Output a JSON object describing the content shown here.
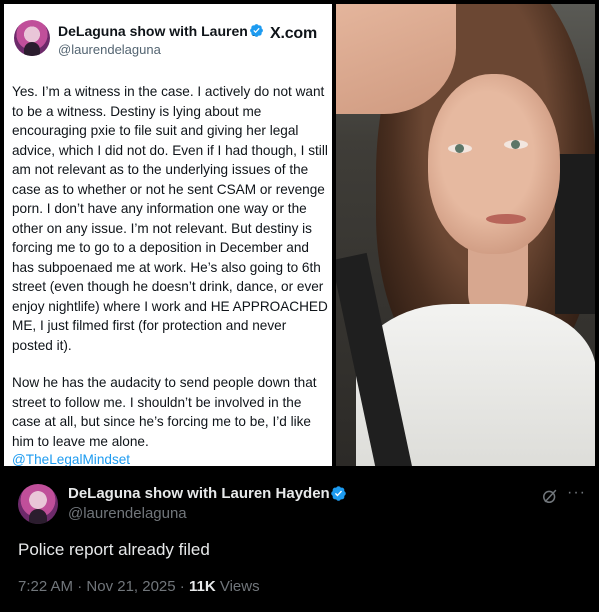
{
  "card": {
    "display_name": "DeLaguna show with Lauren H...",
    "handle": "@laurendelaguna",
    "brand": "X.com",
    "paragraph_1": "Yes. I’m a witness in the case. I actively do not want to be a witness. Destiny is lying about me encouraging pxie to file suit and giving her legal advice, which I did not do. Even if I had though, I still am not relevant as to the underlying issues of the case as to whether or not he sent CSAM or revenge porn. I don’t have any information one way or the other on any issue. I’m not relevant. But destiny is forcing me to go to a deposition in December and has subpoenaed me at work. He’s also going to 6th street (even though he doesn’t drink, dance, or ever enjoy nightlife) where I work and HE APPROACHED ME, I just filmed first (for protection and never posted it).",
    "paragraph_2": "Now he has the audacity to send people down that street to follow me. I shouldn’t be involved in the case at all, but since he’s forcing me to be, I’d like him to leave me alone.",
    "mention": "@TheLegalMindset"
  },
  "tweet": {
    "display_name": "DeLaguna show with Lauren Hayden",
    "handle": "@laurendelaguna",
    "text": "Police report already filed",
    "time": "7:22 AM",
    "separator": " · ",
    "date": "Nov 21, 2025",
    "views_count": "11K",
    "views_label": " Views",
    "more_label": "···"
  },
  "colors": {
    "accent": "#1d9bf0",
    "verified": "#1d9bf0",
    "background": "#000000",
    "card_background": "#ffffff",
    "muted_text": "#71767b"
  },
  "icons": {
    "verified": "verified-badge-icon",
    "grok": "grok-icon",
    "more": "more-icon",
    "brand": "x-logo-icon"
  }
}
